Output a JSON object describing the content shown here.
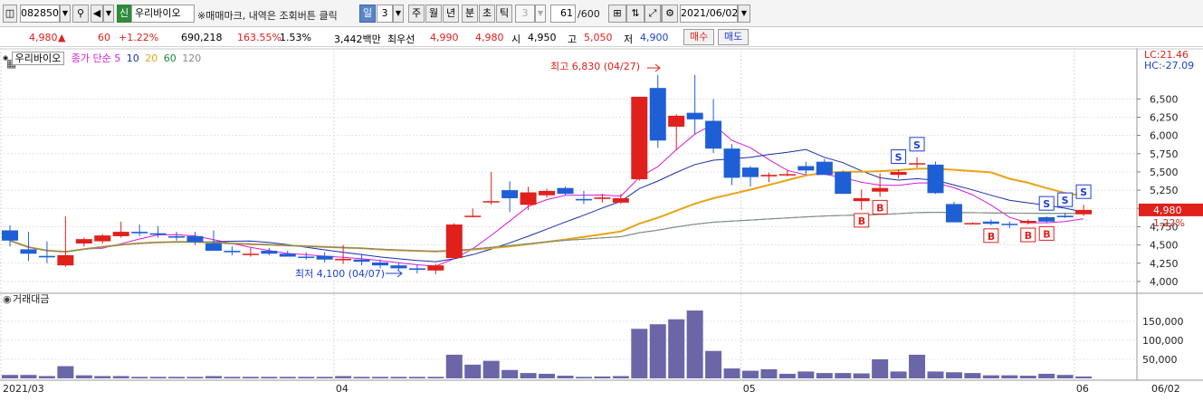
{
  "toolbar": {
    "code": "082850",
    "badge": "신",
    "name": "우리바이오",
    "hint": "※매매마크, 내역은 조회버튼 클릭",
    "periods": [
      "일",
      "3",
      "주",
      "월",
      "년",
      "분",
      "초",
      "틱",
      "3"
    ],
    "count": "61",
    "total": "/600",
    "date": "2021/06/02"
  },
  "quote": {
    "price": "4,980",
    "change": "60",
    "change_pct": "+1.22%",
    "volume": "690,218",
    "vol_ratio": "163.55%",
    "turnover_pct": "1.53%",
    "amount": "3,442백만",
    "best_label": "최우선",
    "ask": "4,990",
    "bid": "4,980",
    "open_label": "시",
    "open": "4,950",
    "high_label": "고",
    "high": "5,050",
    "low_label": "저",
    "low": "4,900",
    "buy_label": "매수",
    "sell_label": "매도"
  },
  "legend": {
    "name": "우리바이오",
    "ma_label": "종가 단순",
    "ma": [
      "5",
      "10",
      "20",
      "60",
      "120"
    ],
    "ma_colors": [
      "#d81bd8",
      "#1a2ea8",
      "#e8a317",
      "#1c8a33",
      "#8a8a8a"
    ]
  },
  "colors": {
    "up": "#e0201b",
    "down": "#1f5fd6",
    "vol": "#6a66a8"
  },
  "chart_data": [
    {
      "type": "candlestick",
      "title": "우리바이오",
      "y_ticks": [
        4000,
        4250,
        4500,
        4750,
        5000,
        5250,
        5500,
        5750,
        6000,
        6250,
        6500
      ],
      "y_tick_labels": [
        "4,000",
        "4,250",
        "4,500",
        "4,750",
        "5,000",
        "5,250",
        "5,500",
        "5,750",
        "6,000",
        "6,250",
        "6,500"
      ],
      "ylim": [
        3900,
        6950
      ],
      "x_labels": [
        "2021/03",
        "04",
        "05",
        "06",
        "06/02"
      ],
      "annotations": {
        "high": "최고 6,830 (04/27)",
        "low": "최저 4,100 (04/07)",
        "lc": "LC:21.46",
        "hc": "HC:-27.09"
      },
      "last_price_label": "4,980",
      "last_change_label": "1.22%",
      "candles": [
        {
          "o": 4700,
          "h": 4770,
          "l": 4480,
          "c": 4560
        },
        {
          "o": 4440,
          "h": 4680,
          "l": 4280,
          "c": 4380
        },
        {
          "o": 4350,
          "h": 4550,
          "l": 4250,
          "c": 4330
        },
        {
          "o": 4220,
          "h": 4890,
          "l": 4200,
          "c": 4360
        },
        {
          "o": 4520,
          "h": 4600,
          "l": 4480,
          "c": 4580
        },
        {
          "o": 4550,
          "h": 4650,
          "l": 4520,
          "c": 4630
        },
        {
          "o": 4620,
          "h": 4820,
          "l": 4600,
          "c": 4680
        },
        {
          "o": 4680,
          "h": 4780,
          "l": 4620,
          "c": 4660
        },
        {
          "o": 4660,
          "h": 4760,
          "l": 4600,
          "c": 4640
        },
        {
          "o": 4620,
          "h": 4680,
          "l": 4560,
          "c": 4600
        },
        {
          "o": 4620,
          "h": 4680,
          "l": 4500,
          "c": 4540
        },
        {
          "o": 4520,
          "h": 4700,
          "l": 4420,
          "c": 4420
        },
        {
          "o": 4420,
          "h": 4480,
          "l": 4360,
          "c": 4400
        },
        {
          "o": 4380,
          "h": 4460,
          "l": 4340,
          "c": 4380
        },
        {
          "o": 4420,
          "h": 4460,
          "l": 4360,
          "c": 4380
        },
        {
          "o": 4380,
          "h": 4420,
          "l": 4340,
          "c": 4340
        },
        {
          "o": 4340,
          "h": 4400,
          "l": 4300,
          "c": 4330
        },
        {
          "o": 4350,
          "h": 4400,
          "l": 4260,
          "c": 4300
        },
        {
          "o": 4290,
          "h": 4500,
          "l": 4240,
          "c": 4310
        },
        {
          "o": 4300,
          "h": 4380,
          "l": 4220,
          "c": 4270
        },
        {
          "o": 4260,
          "h": 4300,
          "l": 4180,
          "c": 4220
        },
        {
          "o": 4220,
          "h": 4260,
          "l": 4160,
          "c": 4180
        },
        {
          "o": 4180,
          "h": 4230,
          "l": 4110,
          "c": 4160
        },
        {
          "o": 4150,
          "h": 4240,
          "l": 4100,
          "c": 4220
        },
        {
          "o": 4320,
          "h": 4800,
          "l": 4320,
          "c": 4780
        },
        {
          "o": 4900,
          "h": 5000,
          "l": 4880,
          "c": 4900
        },
        {
          "o": 5100,
          "h": 5500,
          "l": 5050,
          "c": 5100
        },
        {
          "o": 5250,
          "h": 5370,
          "l": 4950,
          "c": 5140
        },
        {
          "o": 5050,
          "h": 5300,
          "l": 4980,
          "c": 5220
        },
        {
          "o": 5180,
          "h": 5270,
          "l": 5150,
          "c": 5240
        },
        {
          "o": 5280,
          "h": 5300,
          "l": 5180,
          "c": 5200
        },
        {
          "o": 5130,
          "h": 5240,
          "l": 5060,
          "c": 5110
        },
        {
          "o": 5130,
          "h": 5200,
          "l": 5080,
          "c": 5150
        },
        {
          "o": 5080,
          "h": 5200,
          "l": 5060,
          "c": 5140
        },
        {
          "o": 5400,
          "h": 6530,
          "l": 5380,
          "c": 6530
        },
        {
          "o": 6650,
          "h": 6830,
          "l": 5830,
          "c": 5930
        },
        {
          "o": 6120,
          "h": 6290,
          "l": 5800,
          "c": 6270
        },
        {
          "o": 6310,
          "h": 6830,
          "l": 6020,
          "c": 6220
        },
        {
          "o": 6200,
          "h": 6500,
          "l": 5760,
          "c": 5820
        },
        {
          "o": 5820,
          "h": 5880,
          "l": 5320,
          "c": 5420
        },
        {
          "o": 5560,
          "h": 5580,
          "l": 5300,
          "c": 5430
        },
        {
          "o": 5440,
          "h": 5490,
          "l": 5360,
          "c": 5460
        },
        {
          "o": 5460,
          "h": 5520,
          "l": 5440,
          "c": 5470
        },
        {
          "o": 5580,
          "h": 5640,
          "l": 5460,
          "c": 5520
        },
        {
          "o": 5640,
          "h": 5680,
          "l": 5500,
          "c": 5460
        },
        {
          "o": 5500,
          "h": 5520,
          "l": 5200,
          "c": 5200
        },
        {
          "o": 5100,
          "h": 5260,
          "l": 4980,
          "c": 5140
        },
        {
          "o": 5230,
          "h": 5480,
          "l": 5160,
          "c": 5280
        },
        {
          "o": 5460,
          "h": 5530,
          "l": 5410,
          "c": 5500
        },
        {
          "o": 5620,
          "h": 5700,
          "l": 5560,
          "c": 5620
        },
        {
          "o": 5600,
          "h": 5640,
          "l": 5200,
          "c": 5210
        },
        {
          "o": 5060,
          "h": 5090,
          "l": 4900,
          "c": 4810
        },
        {
          "o": 4800,
          "h": 4810,
          "l": 4790,
          "c": 4800
        },
        {
          "o": 4820,
          "h": 4850,
          "l": 4770,
          "c": 4790
        },
        {
          "o": 4790,
          "h": 4820,
          "l": 4730,
          "c": 4780
        },
        {
          "o": 4800,
          "h": 4850,
          "l": 4780,
          "c": 4830
        },
        {
          "o": 4880,
          "h": 4890,
          "l": 4800,
          "c": 4820
        },
        {
          "o": 4900,
          "h": 4940,
          "l": 4870,
          "c": 4880
        },
        {
          "o": 4920,
          "h": 5050,
          "l": 4900,
          "c": 4980
        }
      ]
    },
    {
      "type": "bar",
      "title": "거래대금",
      "y_ticks": [
        50000,
        100000,
        150000
      ],
      "y_tick_labels": [
        "50,000",
        "100,000",
        "150,000"
      ],
      "ylim": [
        0,
        190000
      ],
      "values": [
        9000,
        9000,
        6000,
        32000,
        8000,
        6000,
        6000,
        4000,
        4000,
        4000,
        4000,
        6000,
        4000,
        4000,
        4000,
        4000,
        4000,
        4000,
        6000,
        4000,
        4000,
        4000,
        4000,
        4000,
        62000,
        36000,
        46000,
        22000,
        14000,
        12000,
        7000,
        4000,
        5000,
        6000,
        130000,
        142000,
        155000,
        178000,
        72000,
        26000,
        20000,
        24000,
        12000,
        18000,
        14000,
        14000,
        13000,
        50000,
        18000,
        62000,
        18000,
        16000,
        14000,
        8000,
        8000,
        7000,
        12000,
        9000,
        5000
      ]
    }
  ]
}
